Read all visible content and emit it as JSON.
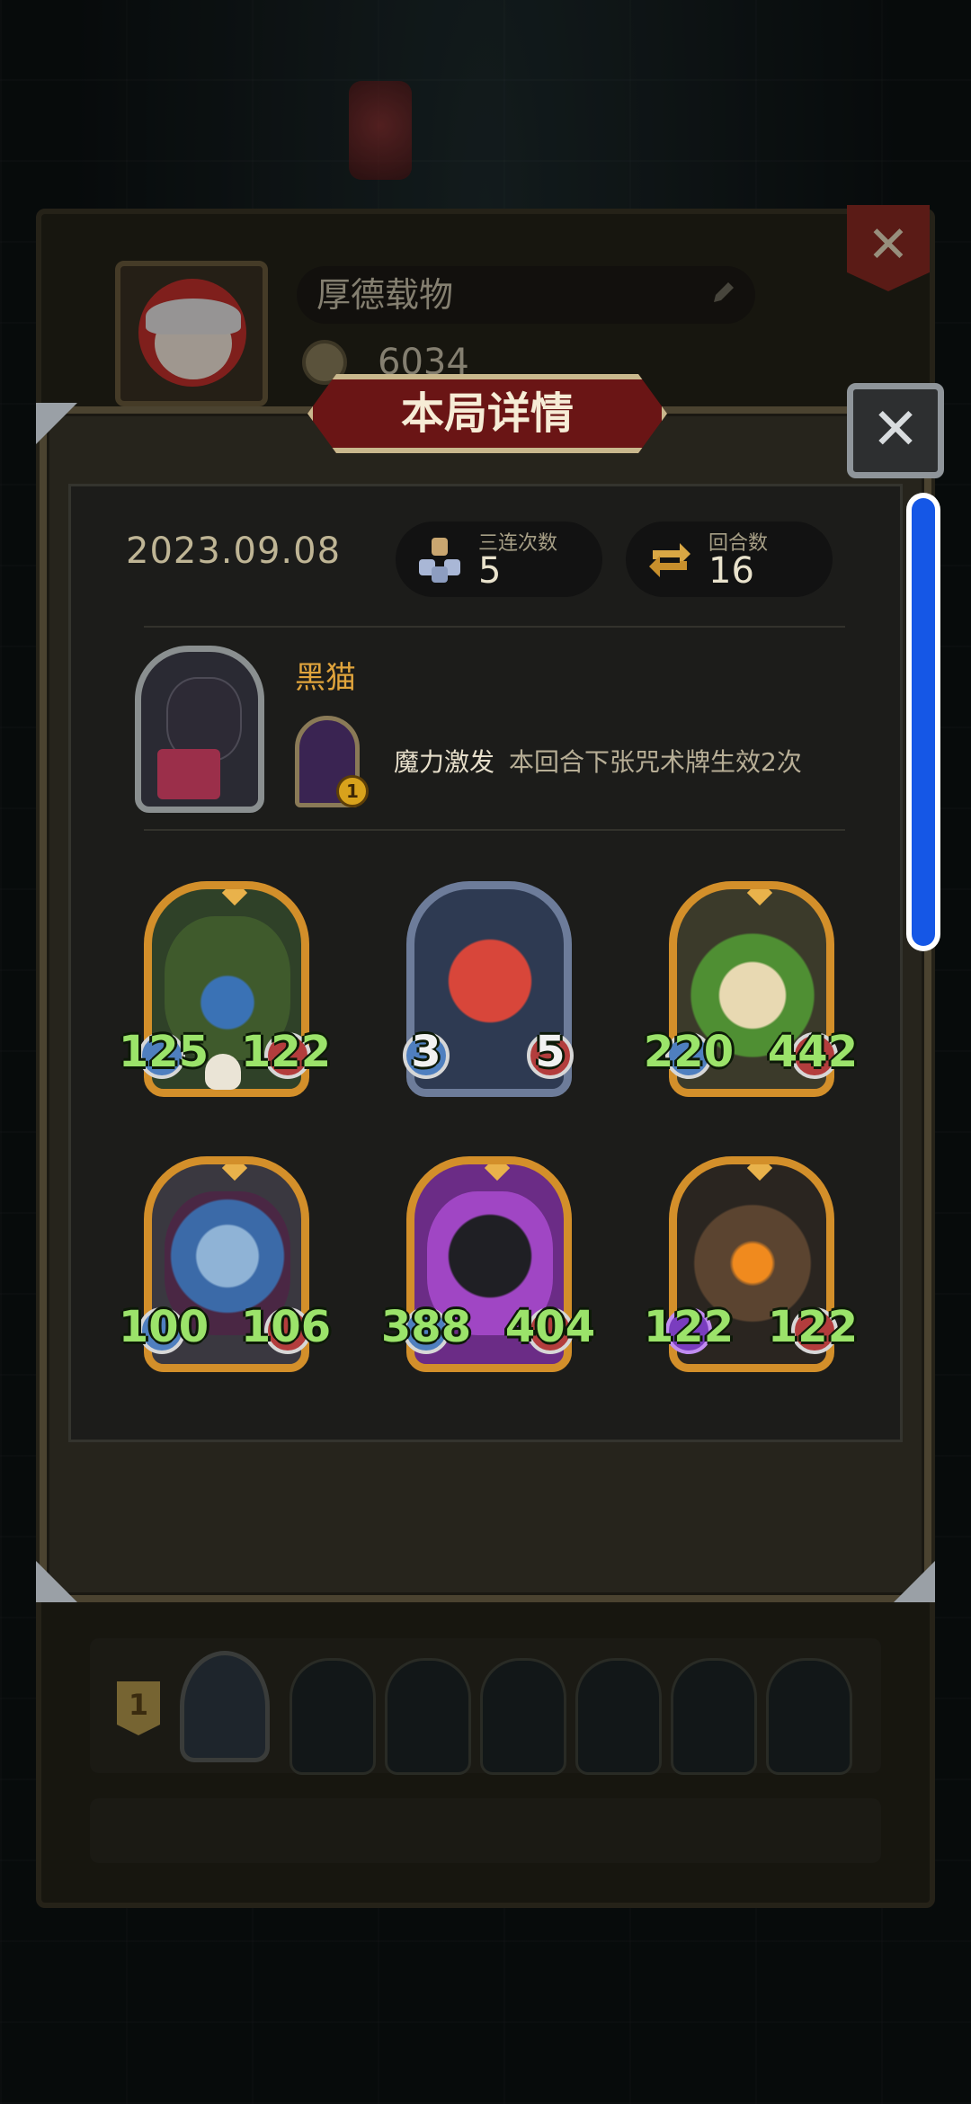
{
  "profile": {
    "name": "厚德载物",
    "coins": "6034"
  },
  "dialog": {
    "title": "本局详情",
    "close_icon": "close-x-icon",
    "date": "2023.09.08",
    "stats": [
      {
        "label": "三连次数",
        "value": "5",
        "icon": "triple-merge-icon"
      },
      {
        "label": "回合数",
        "value": "16",
        "icon": "round-cycle-icon"
      }
    ],
    "hero": {
      "name": "黑猫",
      "skill_level": "1",
      "skill_name": "魔力激发",
      "skill_desc": "本回合下张咒术牌生效2次"
    },
    "cards": [
      {
        "attack": "125",
        "health": "122",
        "frame": "gold",
        "art": "vine-heart-card",
        "extra": "skull-icon"
      },
      {
        "attack": "3",
        "health": "5",
        "frame": "silver",
        "art": "red-imp-card"
      },
      {
        "attack": "220",
        "health": "442",
        "frame": "gold",
        "art": "leaf-sprite-card"
      },
      {
        "attack": "100",
        "health": "106",
        "frame": "gold",
        "art": "sea-witch-card"
      },
      {
        "attack": "388",
        "health": "404",
        "frame": "gold",
        "art": "grinning-demon-card"
      },
      {
        "attack": "122",
        "health": "122",
        "frame": "gold",
        "art": "burning-treant-card"
      }
    ]
  },
  "ranking": {
    "first_rank": "1"
  },
  "colors": {
    "accent_gold": "#d38f2a",
    "stat_green": "#9be36a",
    "banner_red": "#6a1515",
    "scroll_blue": "#1557e6"
  }
}
